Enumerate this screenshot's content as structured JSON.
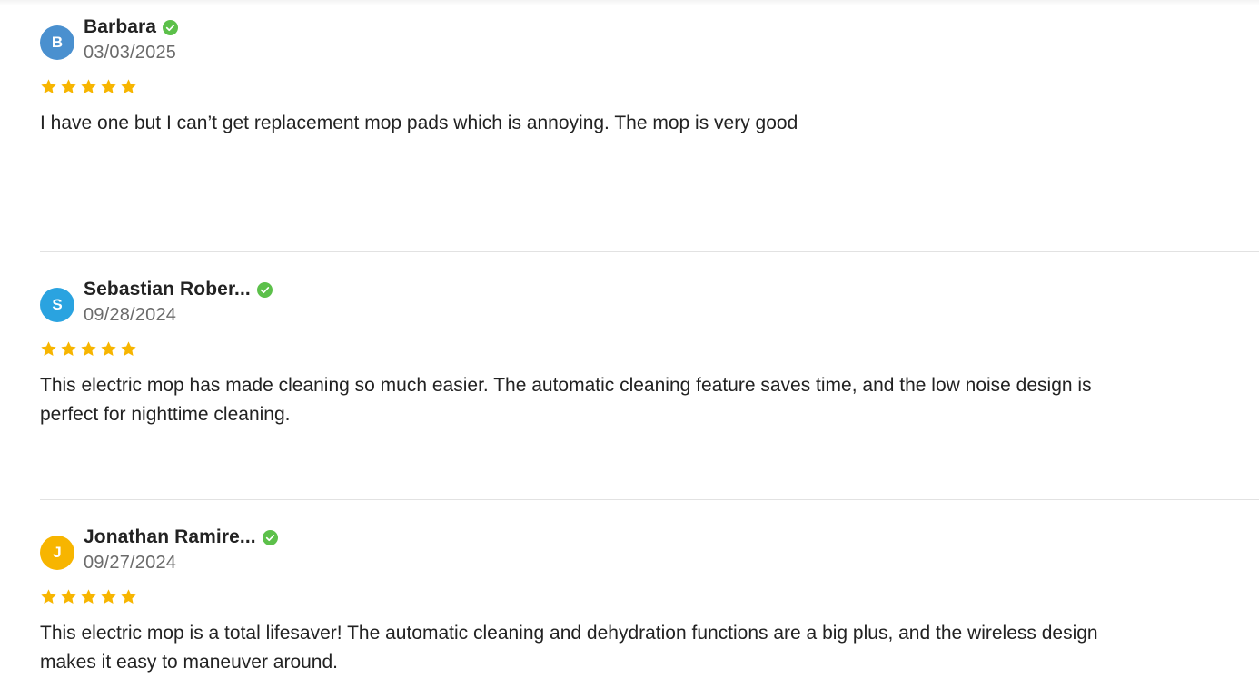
{
  "colors": {
    "verified": "#5cc04a",
    "star": "#f7b500",
    "avatar_b": "#4a90cf",
    "avatar_s": "#2aa3e0",
    "avatar_j": "#f7b500"
  },
  "reviews": [
    {
      "initial": "B",
      "name": "Barbara",
      "date": "03/03/2025",
      "rating": 5,
      "text": "I have one but I can’t get replacement mop pads which is annoying. The mop is very good"
    },
    {
      "initial": "S",
      "name": "Sebastian Rober...",
      "date": "09/28/2024",
      "rating": 5,
      "text": "This electric mop has made cleaning so much easier. The automatic cleaning feature saves time, and the low noise design is perfect for nighttime cleaning."
    },
    {
      "initial": "J",
      "name": "Jonathan Ramire...",
      "date": "09/27/2024",
      "rating": 5,
      "text": "This electric mop is a total lifesaver! The automatic cleaning and dehydration functions are a big plus, and the wireless design makes it easy to maneuver around."
    }
  ]
}
